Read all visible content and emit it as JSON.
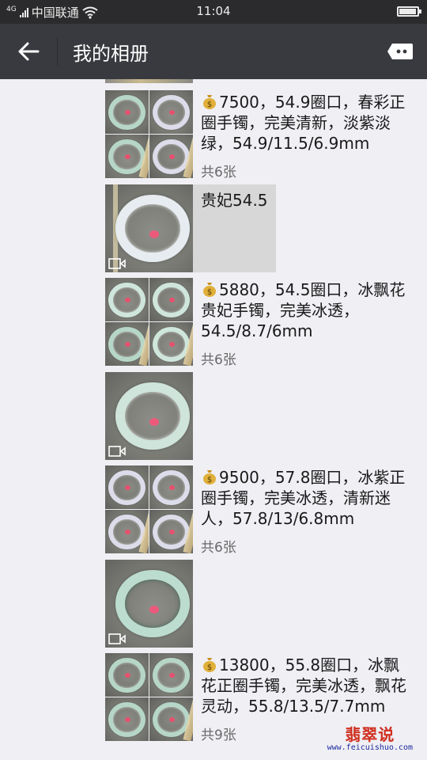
{
  "status_bar": {
    "network_type": "4G",
    "carrier": "中国联通",
    "time": "11:04",
    "battery_percent": 95
  },
  "header": {
    "title": "我的相册",
    "back_icon": "arrow-left-icon",
    "more_icon": "more-dots-icon"
  },
  "posts": [
    {
      "kind": "album",
      "price": "7500",
      "text": "，54.9圈口，春彩正圈手镯，完美清新，淡紫淡绿，54.9/11.5/6.9mm",
      "count": "共6张"
    },
    {
      "kind": "video",
      "caption": "贵妃54.5"
    },
    {
      "kind": "album",
      "price": "5880",
      "text": "，54.5圈口，冰飘花贵妃手镯，完美冰透，54.5/8.7/6mm",
      "count": "共6张"
    },
    {
      "kind": "video",
      "caption": ""
    },
    {
      "kind": "album",
      "price": "9500",
      "text": "，57.8圈口，冰紫正圈手镯，完美冰透，清新迷人，57.8/13/6.8mm",
      "count": "共6张"
    },
    {
      "kind": "video",
      "caption": ""
    },
    {
      "kind": "album",
      "price": "13800",
      "text": "，55.8圈口，冰飘花正圈手镯，完美冰透，飘花灵动，55.8/13.5/7.7mm",
      "count": "共9张"
    }
  ],
  "watermark": {
    "logo_text": "翡翠说",
    "url": "www.feicuishuo.com"
  },
  "colors": {
    "title_bar": "#393a3f",
    "status_bar": "#2b2b2d",
    "background": "#efeff4",
    "watermark_red": "#d03020"
  }
}
